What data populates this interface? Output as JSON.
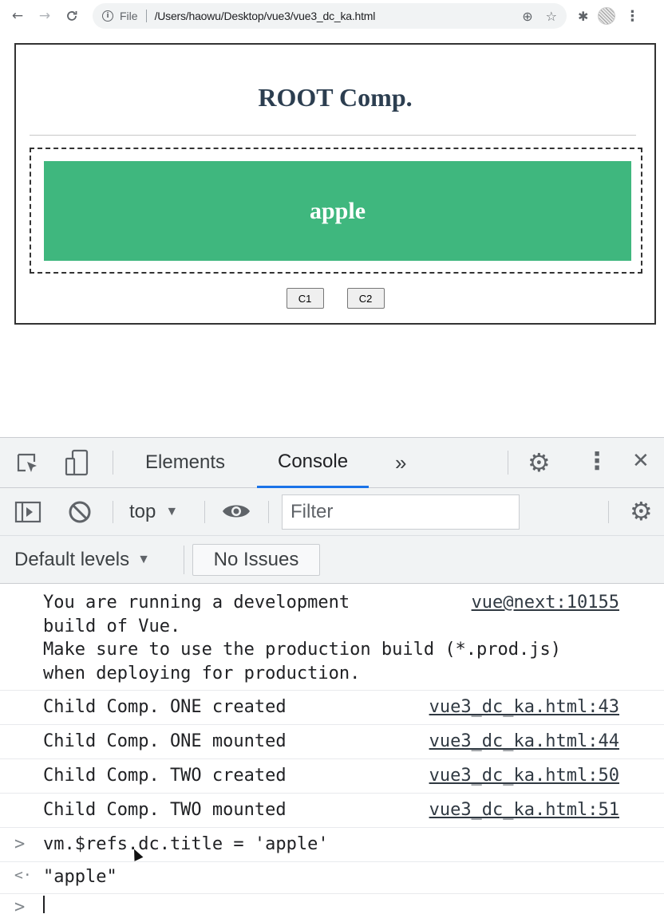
{
  "browser": {
    "back_icon": "←",
    "forward_icon": "→",
    "reload_icon": "C",
    "info_icon": "i",
    "file_label": "File",
    "url": "/Users/haowu/Desktop/vue3/vue3_dc_ka.html",
    "zoom_icon": "⊕",
    "star_icon": "☆",
    "extension_icon": "✱",
    "menu_icon": "⋮"
  },
  "page": {
    "root_title": "ROOT Comp.",
    "child_title": "apple",
    "buttons": [
      "C1",
      "C2"
    ],
    "accent_color": "#3fb77e"
  },
  "devtools": {
    "tabs": [
      "Elements",
      "Console"
    ],
    "more_tabs_icon": "»",
    "settings_icon": "⚙",
    "menu_icon": "⋮",
    "close_icon": "✕",
    "context": "top",
    "dropdown_icon": "▼",
    "filter_placeholder": "Filter",
    "levels": "Default levels",
    "issues": "No Issues",
    "console": {
      "vue_warning_lines": [
        "You are running a development",
        "build of Vue.",
        "Make sure to use the production build (*.prod.js)",
        "when deploying for production."
      ],
      "vue_warning_source": "vue@next:10155",
      "logs": [
        {
          "text": "Child Comp. ONE created",
          "source": "vue3_dc_ka.html:43"
        },
        {
          "text": "Child Comp. ONE mounted",
          "source": "vue3_dc_ka.html:44"
        },
        {
          "text": "Child Comp. TWO created",
          "source": "vue3_dc_ka.html:50"
        },
        {
          "text": "Child Comp. TWO mounted",
          "source": "vue3_dc_ka.html:51"
        }
      ],
      "input_command": "vm.$refs.dc.title = 'apple'",
      "result": "\"apple\"",
      "prompt_icon": ">",
      "result_icon": "<·"
    }
  }
}
